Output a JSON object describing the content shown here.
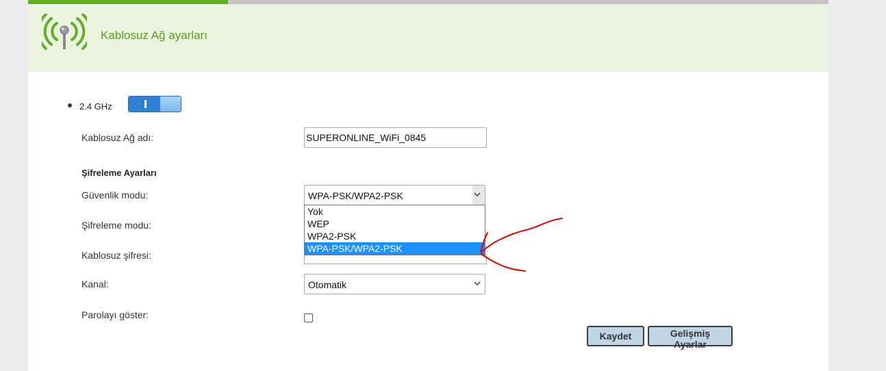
{
  "progress": {
    "value": 0.25
  },
  "header": {
    "title": "Kablosuz Ağ ayarları",
    "icon": "wifi-antenna-icon",
    "accent": "#5fae26"
  },
  "band": {
    "label": "2.4 GHz",
    "toggle_on": true
  },
  "form": {
    "ssid": {
      "label": "Kablosuz Ağ adı:",
      "value": "SUPERONLINE_WiFi_0845"
    },
    "section_title": "Şifreleme Ayarları",
    "security_mode": {
      "label": "Güvenlik modu:",
      "value": "WPA-PSK/WPA2-PSK",
      "options": [
        "Yok",
        "WEP",
        "WPA2-PSK",
        "WPA-PSK/WPA2-PSK"
      ],
      "selected_index": 3
    },
    "encryption_mode": {
      "label": "Şifreleme modu:"
    },
    "wireless_password": {
      "label": "Kablosuz şifresi:"
    },
    "channel": {
      "label": "Kanal:",
      "value": "Otomatik"
    },
    "show_password": {
      "label": "Parolayı göster:",
      "checked": false
    }
  },
  "buttons": {
    "save": "Kaydet",
    "advanced": "Gelişmiş Ayarlar"
  },
  "annotation": {
    "color": "#e00000",
    "shape": "red-arrow"
  }
}
